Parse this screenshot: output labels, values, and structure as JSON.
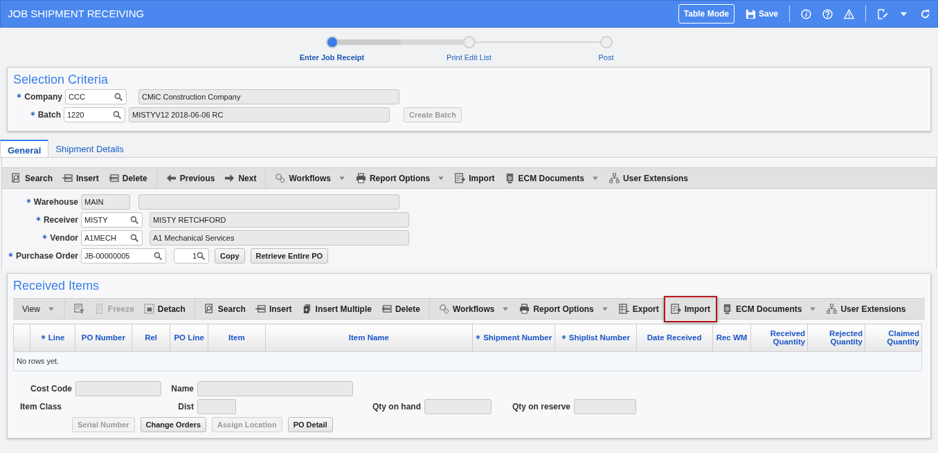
{
  "header": {
    "title": "JOB SHIPMENT RECEIVING",
    "table_mode": "Table Mode",
    "save": "Save"
  },
  "steps": [
    {
      "label": "Enter Job Receipt",
      "selected": true
    },
    {
      "label": "Print Edit List",
      "selected": false
    },
    {
      "label": "Post",
      "selected": false
    }
  ],
  "selection_criteria": {
    "title": "Selection Criteria",
    "rows": [
      {
        "label": "Company",
        "required": true,
        "value": "CCC",
        "description": "CMiC Construction Company"
      },
      {
        "label": "Batch",
        "required": true,
        "value": "1220",
        "description": "MISTYV12 2018-06-06 RC",
        "button": {
          "label": "Create Batch",
          "disabled": true
        }
      }
    ]
  },
  "tabs": [
    {
      "label": "General",
      "selected": true
    },
    {
      "label": "Shipment Details",
      "selected": false
    }
  ],
  "toolbar": [
    [
      {
        "kind": "search",
        "label": "Search"
      },
      {
        "kind": "insert",
        "label": "Insert"
      },
      {
        "kind": "delete",
        "label": "Delete"
      }
    ],
    [
      {
        "kind": "previous",
        "label": "Previous"
      },
      {
        "kind": "next",
        "label": "Next"
      }
    ],
    [
      {
        "kind": "workflows",
        "label": "Workflows",
        "dropdown": true
      },
      {
        "kind": "print",
        "label": "Report Options",
        "dropdown": true
      },
      {
        "kind": "import",
        "label": "Import"
      },
      {
        "kind": "ecm",
        "label": "ECM Documents",
        "dropdown": true
      },
      {
        "kind": "extensions",
        "label": "User Extensions"
      }
    ]
  ],
  "general_form": [
    {
      "label": "Warehouse",
      "required": true,
      "value": "MAIN",
      "readonly": true,
      "lookup": false
    },
    {
      "label": "Receiver",
      "required": true,
      "value": "MISTY",
      "readonly": false,
      "lookup": true,
      "description": "MISTY RETCHFORD"
    },
    {
      "label": "Vendor",
      "required": true,
      "value": "A1MECH",
      "readonly": false,
      "lookup": true,
      "description": "A1 Mechanical Services"
    },
    {
      "label": "Purchase Order",
      "required": true,
      "value": "JB-00000005",
      "readonly": false,
      "lookup": true,
      "release": "1",
      "buttons": [
        "Copy",
        "Retrieve Entire PO"
      ]
    }
  ],
  "received_items": {
    "title": "Received Items",
    "toolbar": [
      [
        {
          "kind": "view",
          "label": "View",
          "dropdown": true
        }
      ],
      [
        {
          "kind": "filter"
        },
        {
          "kind": "freeze",
          "label": "Freeze",
          "disabled": true
        },
        {
          "kind": "detach",
          "label": "Detach"
        }
      ],
      [
        {
          "kind": "search",
          "label": "Search"
        },
        {
          "kind": "insert",
          "label": "Insert"
        },
        {
          "kind": "insert_multiple",
          "label": "Insert Multiple"
        },
        {
          "kind": "delete",
          "label": "Delete"
        }
      ],
      [
        {
          "kind": "workflows",
          "label": "Workflows",
          "dropdown": true
        },
        {
          "kind": "print",
          "label": "Report Options",
          "dropdown": true
        },
        {
          "kind": "export",
          "label": "Export"
        },
        {
          "kind": "import",
          "label": "Import",
          "highlighted": true
        },
        {
          "kind": "ecm",
          "label": "ECM Documents",
          "dropdown": true
        },
        {
          "kind": "extensions",
          "label": "User Extensions"
        }
      ]
    ],
    "columns": [
      {
        "label": "Line",
        "required": true
      },
      {
        "label": "PO Number",
        "required": false
      },
      {
        "label": "Rel",
        "required": false
      },
      {
        "label": "PO Line",
        "required": false
      },
      {
        "label": "Item",
        "required": false
      },
      {
        "label": "Item Name",
        "required": false
      },
      {
        "label": "Shipment Number",
        "required": true
      },
      {
        "label": "Shiplist Number",
        "required": true
      },
      {
        "label": "Date Received",
        "required": false
      },
      {
        "label": "Rec WM",
        "required": false
      },
      {
        "label": "Received Quantity",
        "required": false
      },
      {
        "label": "Rejected Quantity",
        "required": false
      },
      {
        "label": "Claimed Quantity",
        "required": false
      }
    ],
    "empty_text": "No rows yet.",
    "details": {
      "cost_code": "Cost Code",
      "name": "Name",
      "item_class": "Item Class",
      "dist": "Dist",
      "qty_on_hand": "Qty on hand",
      "qty_on_reserve": "Qty on reserve"
    },
    "buttons": [
      {
        "label": "Serial Number",
        "disabled": true
      },
      {
        "label": "Change Orders",
        "disabled": false
      },
      {
        "label": "Assign Location",
        "disabled": true
      },
      {
        "label": "PO Detail",
        "disabled": false
      }
    ]
  }
}
